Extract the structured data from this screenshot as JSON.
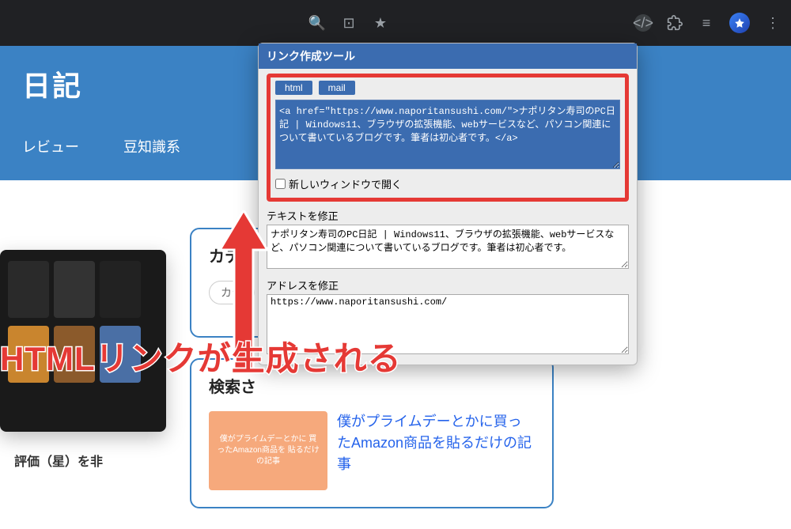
{
  "browser": {
    "icons": {
      "zoom": "🔍",
      "camera": "⊡",
      "star": "★",
      "ext_active": "</>",
      "puzzle": "🧩",
      "menu_lines": "≡",
      "dots": "⋮"
    }
  },
  "page": {
    "title_partial": "日記",
    "nav": {
      "review": "レビュー",
      "trivia": "豆知識系"
    },
    "star_caption": "評価（星）を非",
    "category": {
      "heading_partial": "カテ",
      "pill_partial": "カテ"
    },
    "search": {
      "heading_partial": "検索さ"
    },
    "article": {
      "orange_card_text": "僕がプライムデーとかに\n買ったAmazon商品を\n貼るだけの記事",
      "link": "僕がプライムデーとかに買ったAmazon商品を貼るだけの記事",
      "link_partial": "記事"
    }
  },
  "popup": {
    "title": "リンク作成ツール",
    "tabs": {
      "html": "html",
      "mail": "mail"
    },
    "code": "<a href=\"https://www.naporitansushi.com/\">ナポリタン寿司のPC日記 | Windows11、ブラウザの拡張機能、webサービスなど、パソコン関連について書いているブログです。筆者は初心者です。</a>",
    "new_window": "新しいウィンドウで開く",
    "fix_text_label": "テキストを修正",
    "fix_text_value": "ナポリタン寿司のPC日記 | Windows11、ブラウザの拡張機能、webサービスなど、パソコン関連について書いているブログです。筆者は初心者です。",
    "fix_addr_label": "アドレスを修正",
    "fix_addr_value": "https://www.naporitansushi.com/"
  },
  "annotation": "HTMLリンクが生成される"
}
